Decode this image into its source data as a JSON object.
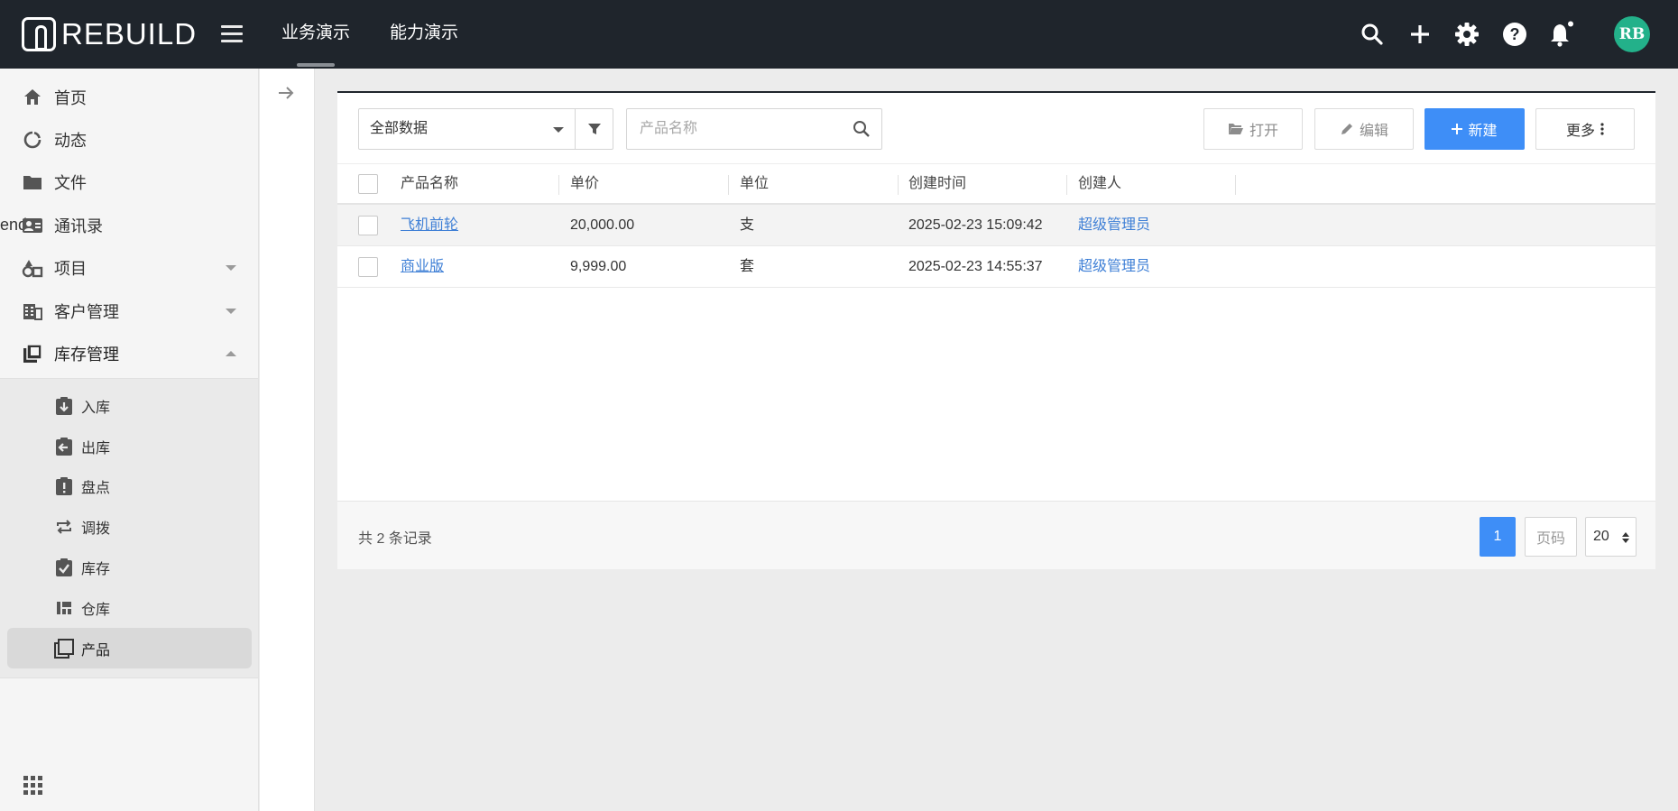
{
  "app": {
    "logo_text": "REBUILD",
    "avatar_initials": "RB"
  },
  "topnav": {
    "tabs": [
      {
        "label": "业务演示",
        "active": true
      },
      {
        "label": "能力演示",
        "active": false
      }
    ],
    "icons": [
      "search-icon",
      "plus-icon",
      "gear-icon",
      "help-icon",
      "bell-icon"
    ]
  },
  "sidebar": {
    "items": [
      {
        "label": "首页",
        "icon": "home-icon"
      },
      {
        "label": "动态",
        "icon": "feed-icon"
      },
      {
        "label": "文件",
        "icon": "folder-icon"
      },
      {
        "label": "通讯录",
        "icon": "contacts-icon"
      },
      {
        "label": "项目",
        "icon": "project-icon"
      },
      {
        "label": "客户管理",
        "icon": "building-icon"
      },
      {
        "label": "库存管理",
        "icon": "inventory-icon"
      }
    ],
    "submenu": [
      {
        "label": "入库",
        "icon": "stock-in-icon"
      },
      {
        "label": "出库",
        "icon": "stock-out-icon"
      },
      {
        "label": "盘点",
        "icon": "stocktake-icon"
      },
      {
        "label": "调拨",
        "icon": "transfer-icon"
      },
      {
        "label": "库存",
        "icon": "stock-icon"
      },
      {
        "label": "仓库",
        "icon": "warehouse-icon"
      },
      {
        "label": "产品",
        "icon": "product-icon",
        "active": true
      }
    ]
  },
  "toolbar": {
    "filter_select": "全部数据",
    "search_placeholder": "产品名称",
    "open_label": "打开",
    "edit_label": "编辑",
    "new_label": "新建",
    "more_label": "更多"
  },
  "table": {
    "columns": [
      "产品名称",
      "单价",
      "单位",
      "创建时间",
      "创建人"
    ],
    "rows": [
      {
        "name": "飞机前轮",
        "price": "20,000.00",
        "unit": "支",
        "created": "2025-02-23 15:09:42",
        "creator": "超级管理员"
      },
      {
        "name": "商业版",
        "price": "9,999.00",
        "unit": "套",
        "created": "2025-02-23 14:55:37",
        "creator": "超级管理员"
      }
    ]
  },
  "footer": {
    "total_text": "共 2 条记录",
    "current_page": "1",
    "page_input_placeholder": "页码",
    "page_size": "20"
  },
  "colors": {
    "topbar": "#1f252c",
    "accent": "#3e8ef7",
    "avatar": "#23b18a",
    "link": "#3e7fd6"
  }
}
